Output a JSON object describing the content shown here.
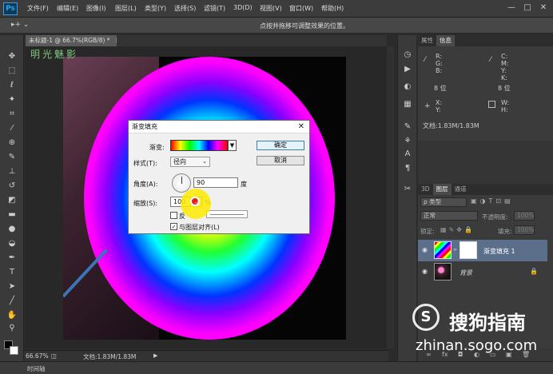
{
  "app": {
    "logo": "Ps"
  },
  "menubar": {
    "items": [
      "文件(F)",
      "编辑(E)",
      "图像(I)",
      "图层(L)",
      "类型(Y)",
      "选择(S)",
      "滤镜(T)",
      "3D(D)",
      "视图(V)",
      "窗口(W)",
      "帮助(H)"
    ]
  },
  "window_controls": {
    "minimize": "—",
    "maximize": "□",
    "close": "✕"
  },
  "options_bar": {
    "hint": "点按并拖移可调整效果的位置。",
    "tool_glyph": "▸+ ⌄"
  },
  "document": {
    "tab_label": "未标题-1 @ 66.7%(RGB/8) *",
    "tab_close": "×",
    "watermark_text": "明光魅影"
  },
  "toolbox": {
    "icons": [
      "move-icon",
      "marquee-icon",
      "lasso-icon",
      "magic-wand-icon",
      "crop-icon",
      "eyedropper-icon",
      "healing-icon",
      "brush-icon",
      "stamp-icon",
      "history-brush-icon",
      "eraser-icon",
      "gradient-icon",
      "blur-icon",
      "dodge-icon",
      "pen-icon",
      "type-icon",
      "path-select-icon",
      "shape-icon",
      "hand-icon",
      "zoom-icon"
    ]
  },
  "status_bar": {
    "zoom": "66.67%",
    "doc_info": "文档:1.83M/1.83M",
    "arrow": "▶"
  },
  "timeline": {
    "label": "时间轴"
  },
  "info_panel": {
    "tabs": [
      "属性",
      "信息"
    ],
    "active_tab": "信息",
    "rgb_labels": [
      "R:",
      "G:",
      "B:"
    ],
    "cmyk_labels": [
      "C:",
      "M:",
      "Y:",
      "K:"
    ],
    "bit_left": "8 位",
    "bit_right": "8 位",
    "xy_labels": [
      "X:",
      "Y:"
    ],
    "wh_labels": [
      "W:",
      "H:"
    ],
    "doc_info": "文档:1.83M/1.83M"
  },
  "layers_panel": {
    "tabs": [
      "3D",
      "图层",
      "通道"
    ],
    "active_tab": "图层",
    "filter_kind": "ρ 类型",
    "blend_mode": "正常",
    "opacity_label": "不透明度:",
    "opacity_value": "100%",
    "lock_label": "锁定:",
    "fill_label": "填充:",
    "fill_value": "100%",
    "layers": [
      {
        "name": "渐变填充 1",
        "selected": true
      },
      {
        "name": "背景",
        "selected": false,
        "locked": true
      }
    ],
    "footer_icons": [
      "link-icon",
      "fx-icon",
      "mask-icon",
      "adjustment-icon",
      "folder-icon",
      "new-layer-icon",
      "trash-icon"
    ]
  },
  "dialog": {
    "title": "渐变填充",
    "close": "✕",
    "gradient_label": "渐变:",
    "style_label": "样式(T):",
    "style_value": "径向",
    "angle_label": "角度(A):",
    "angle_value": "90",
    "angle_unit": "度",
    "scale_label": "缩放(S):",
    "scale_value": "100",
    "scale_unit": "%",
    "reverse_label": "反",
    "align_label": "与图层对齐(L)",
    "ok_label": "确定",
    "cancel_label": "取消"
  },
  "overlay": {
    "brand_cn": "搜狗指南",
    "brand_url": "zhinan.sogo.com",
    "brand_logo": "S"
  },
  "colors": {
    "accent": "#2fa3e6",
    "menubar": "#3c3c3c",
    "panel": "#3b3b3b",
    "selected_layer": "#5c6f8a",
    "highlight": "#ffeb00"
  }
}
